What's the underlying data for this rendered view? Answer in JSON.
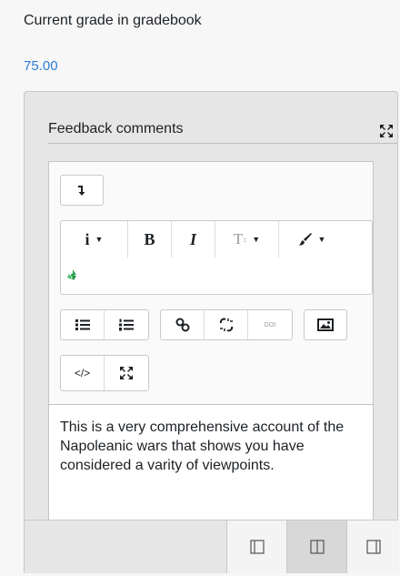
{
  "grade": {
    "label": "Current grade in gradebook",
    "value": "75.00"
  },
  "feedback": {
    "title": "Feedback comments",
    "text": "This is a very comprehensive account of the Napoleanic wars that shows you have considered a varity of viewpoints."
  },
  "toolbar": {
    "collapse_icon": "arrow-down-icon",
    "info_label": "i",
    "bold_label": "B",
    "italic_label": "I",
    "font_size_label": "T",
    "doi_label": "DOI",
    "html_label": "</>"
  },
  "colors": {
    "link": "#2c7bd6",
    "panel_bg": "#e6e6e6",
    "page_bg": "#f7f7f7"
  }
}
